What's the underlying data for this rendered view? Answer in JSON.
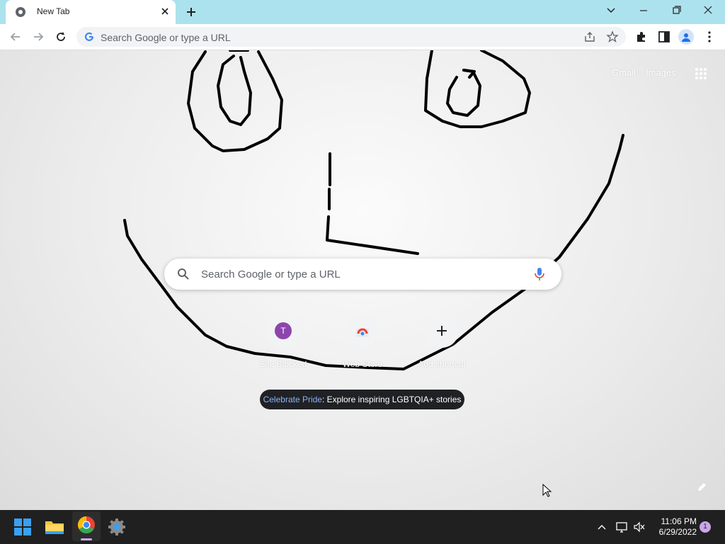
{
  "tab": {
    "title": "New Tab"
  },
  "omnibox": {
    "placeholder": "Search Google or type a URL"
  },
  "ntp": {
    "links": {
      "gmail": "Gmail",
      "images": "Images"
    },
    "search_placeholder": "Search Google or type a URL",
    "shortcuts": [
      {
        "label": "Site Blocked",
        "letter": "T"
      },
      {
        "label": "Web Store"
      },
      {
        "label": "Add shortcut"
      }
    ],
    "promo": {
      "link": "Celebrate Pride",
      "text": ": Explore inspiring LGBTQIA+ stories"
    }
  },
  "taskbar": {
    "time": "11:06 PM",
    "date": "6/29/2022",
    "notification_count": "1"
  },
  "colors": {
    "tabstrip": "#ace2ee",
    "promo_link": "#8ab4f8",
    "taskbar": "#202020"
  },
  "icons": [
    "chrome-icon",
    "close-icon",
    "plus-icon",
    "chevron-down-icon",
    "minimize-icon",
    "restore-icon",
    "back-arrow-icon",
    "forward-arrow-icon",
    "reload-icon",
    "google-g-icon",
    "share-icon",
    "star-icon",
    "extensions-icon",
    "side-panel-icon",
    "profile-icon",
    "kebab-menu-icon",
    "apps-grid-icon",
    "search-icon",
    "mic-icon",
    "pencil-icon",
    "windows-start-icon",
    "file-explorer-icon",
    "settings-icon",
    "chevron-up-icon",
    "network-icon",
    "volume-muted-icon",
    "cursor-icon"
  ]
}
